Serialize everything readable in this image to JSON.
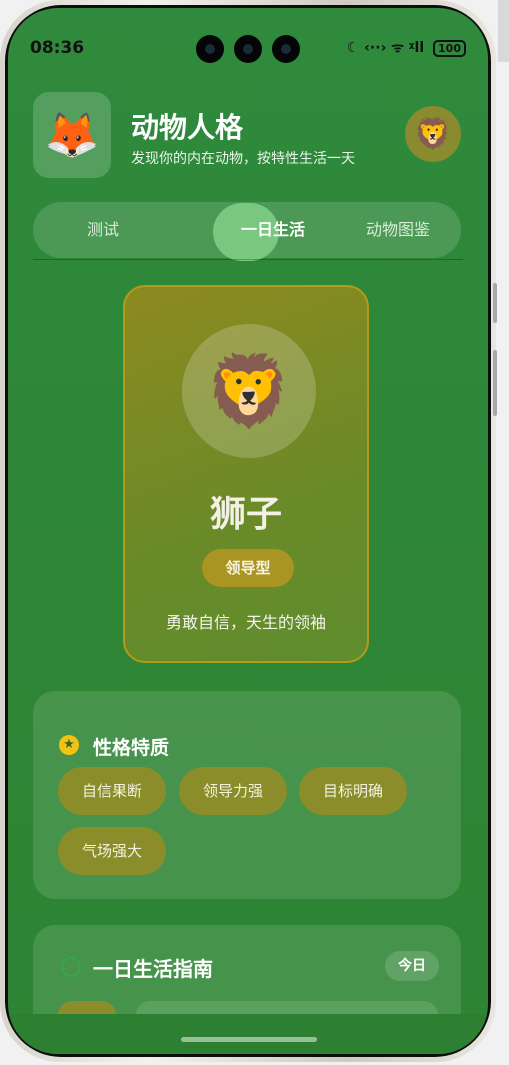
{
  "status": {
    "time": "08:36",
    "icons": "☾ ‹··› ᯤ ᵡll",
    "battery": "100"
  },
  "header": {
    "logo_icon": "fox-emoji",
    "logo_glyph": "🦊",
    "title": "动物人格",
    "subtitle": "发现你的内在动物，按特性生活一天",
    "avatar_icon": "lion-emoji",
    "avatar_glyph": "🦁"
  },
  "tabs": [
    {
      "label": "测试"
    },
    {
      "label": "一日生活",
      "active": true
    },
    {
      "label": "动物图鉴"
    }
  ],
  "animal": {
    "glyph": "🦁",
    "name": "狮子",
    "type": "领导型",
    "description": "勇敢自信，天生的领袖"
  },
  "traits": {
    "title": "性格特质",
    "icon": "star-icon",
    "items": [
      "自信果断",
      "领导力强",
      "目标明确",
      "气场强大"
    ]
  },
  "guide": {
    "title": "一日生活指南",
    "icon": "clock-icon",
    "today_label": "今日"
  },
  "colors": {
    "background": "#2f8a3d",
    "card_border": "#b29a1a",
    "chip": "#8a8d2a",
    "star": "#f2c313"
  }
}
